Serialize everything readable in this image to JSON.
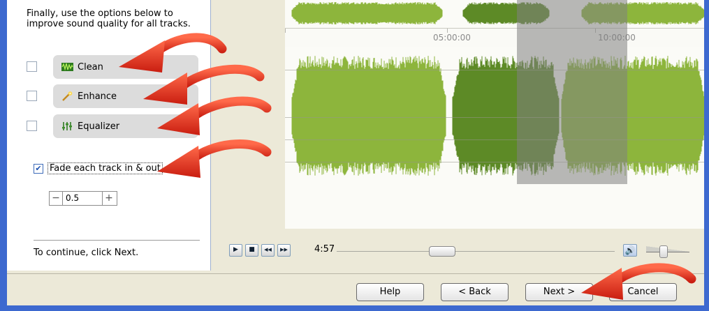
{
  "left_panel": {
    "intro_text": "Finally, use the options below to improve sound quality for all tracks.",
    "options": [
      {
        "label": "Clean",
        "checked": false,
        "icon": "clean-icon"
      },
      {
        "label": "Enhance",
        "checked": false,
        "icon": "enhance-wand-icon"
      },
      {
        "label": "Equalizer",
        "checked": false,
        "icon": "equalizer-icon"
      }
    ],
    "fade": {
      "label": "Fade each track in & out",
      "checked": true
    },
    "fade_duration": {
      "value": "0.5",
      "minus": "−",
      "plus": "+"
    },
    "continue_text": "To continue, click Next."
  },
  "timeline": {
    "ruler_labels": [
      "05:00:00",
      "10:00:00"
    ],
    "waveform_color": "#8db53c",
    "waveform_selected_color": "#5d8a26"
  },
  "transport": {
    "buttons": [
      {
        "name": "play-button",
        "icon": "play-icon",
        "glyph": "▶"
      },
      {
        "name": "stop-button",
        "icon": "stop-icon",
        "glyph": "■"
      },
      {
        "name": "previous-button",
        "icon": "skip-back-icon",
        "glyph": "◀◀"
      },
      {
        "name": "next-track-button",
        "icon": "skip-forward-icon",
        "glyph": "▶▶"
      }
    ],
    "time": "4:57",
    "position_fraction": 0.38,
    "volume_fraction": 0.4
  },
  "dialog_buttons": {
    "help": "Help",
    "back": "< Back",
    "next": "Next >",
    "cancel": "Cancel"
  },
  "colors": {
    "window_frame": "#3d69cf",
    "arrow_red": "#e8321f"
  }
}
